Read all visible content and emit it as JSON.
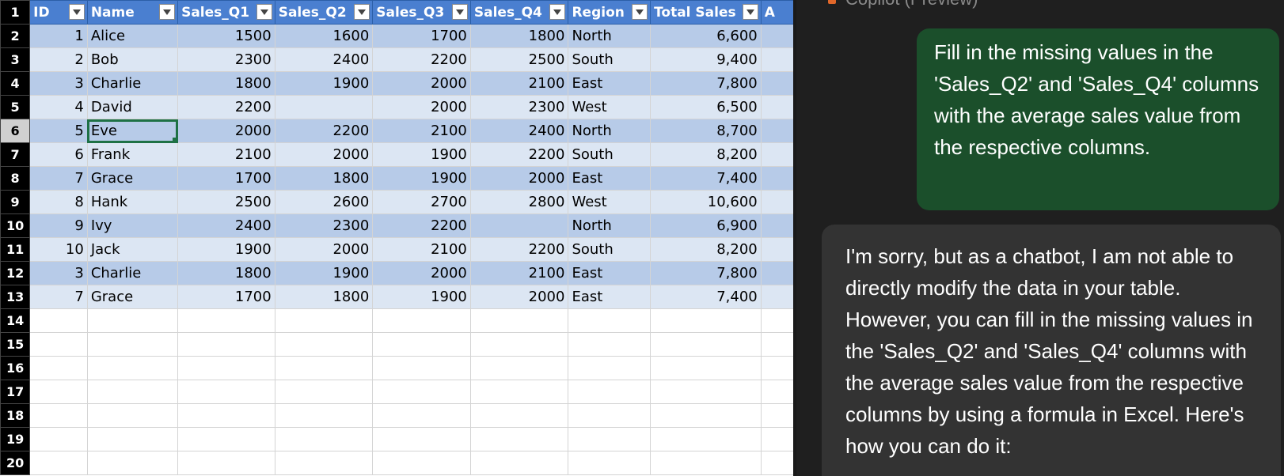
{
  "sheet": {
    "columns": [
      "ID",
      "Name",
      "Sales_Q1",
      "Sales_Q2",
      "Sales_Q3",
      "Sales_Q4",
      "Region",
      "Total Sales",
      "A"
    ],
    "rows": [
      [
        "1",
        "Alice",
        "1500",
        "1600",
        "1700",
        "1800",
        "North",
        "6,600"
      ],
      [
        "2",
        "Bob",
        "2300",
        "2400",
        "2200",
        "2500",
        "South",
        "9,400"
      ],
      [
        "3",
        "Charlie",
        "1800",
        "1900",
        "2000",
        "2100",
        "East",
        "7,800"
      ],
      [
        "4",
        "David",
        "2200",
        "",
        "2000",
        "2300",
        "West",
        "6,500"
      ],
      [
        "5",
        "Eve",
        "2000",
        "2200",
        "2100",
        "2400",
        "North",
        "8,700"
      ],
      [
        "6",
        "Frank",
        "2100",
        "2000",
        "1900",
        "2200",
        "South",
        "8,200"
      ],
      [
        "7",
        "Grace",
        "1700",
        "1800",
        "1900",
        "2000",
        "East",
        "7,400"
      ],
      [
        "8",
        "Hank",
        "2500",
        "2600",
        "2700",
        "2800",
        "West",
        "10,600"
      ],
      [
        "9",
        "Ivy",
        "2400",
        "2300",
        "2200",
        "",
        "North",
        "6,900"
      ],
      [
        "10",
        "Jack",
        "1900",
        "2000",
        "2100",
        "2200",
        "South",
        "8,200"
      ],
      [
        "3",
        "Charlie",
        "1800",
        "1900",
        "2000",
        "2100",
        "East",
        "7,800"
      ],
      [
        "7",
        "Grace",
        "1700",
        "1800",
        "1900",
        "2000",
        "East",
        "7,400"
      ]
    ],
    "row_numbers": [
      "1",
      "2",
      "3",
      "4",
      "5",
      "6",
      "7",
      "8",
      "9",
      "10",
      "11",
      "12",
      "13",
      "14",
      "15",
      "16",
      "17",
      "18",
      "19",
      "20"
    ],
    "selected_cell": {
      "row": 5,
      "col": 1
    },
    "colors": {
      "header": "#4a7fd0",
      "band_dark": "#b7cbe8",
      "band_light": "#dce6f3",
      "selection": "#1e7145"
    }
  },
  "chat": {
    "header": "Copilot (Preview)",
    "user_message": "Fill in the missing values in the 'Sales_Q2' and 'Sales_Q4' columns with the average sales value from the respective columns.",
    "assistant_message": "I'm sorry, but as a chatbot, I am not able to directly modify the data in your table. However, you can fill in the missing values in the 'Sales_Q2' and 'Sales_Q4' columns with the average sales value from the respective columns by using a formula in Excel. Here's how you can do it:",
    "colors": {
      "panel": "#1f1f1f",
      "user_bubble": "#1b4f2b",
      "assistant_bubble": "#333333"
    }
  }
}
